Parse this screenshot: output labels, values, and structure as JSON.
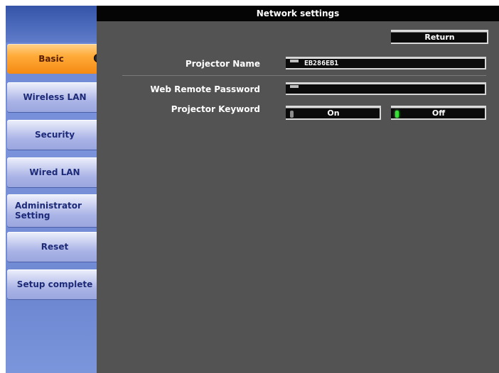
{
  "window": {
    "title": "Network settings"
  },
  "sidebar": {
    "items": [
      {
        "label": "Basic",
        "active": true
      },
      {
        "label": "Wireless LAN",
        "active": false
      },
      {
        "label": "Security",
        "active": false
      },
      {
        "label": "Wired LAN",
        "active": false
      },
      {
        "label": "Administrator\nSetting",
        "active": false
      },
      {
        "label": "Reset",
        "active": false
      },
      {
        "label": "Setup complete",
        "active": false
      }
    ],
    "active_icon": "arrow-circle-icon"
  },
  "toolbar": {
    "return_label": "Return"
  },
  "form": {
    "projector_name": {
      "label": "Projector Name",
      "value": "EB286EB1"
    },
    "web_remote_password": {
      "label": "Web Remote Password",
      "value": ""
    },
    "projector_keyword": {
      "label": "Projector Keyword",
      "on_label": "On",
      "off_label": "Off",
      "selected": "Off"
    }
  },
  "colors": {
    "active_tab": "#f58a12",
    "panel_background": "#535353",
    "titlebar": "#050505",
    "selected_indicator": "#3ddc3d"
  }
}
